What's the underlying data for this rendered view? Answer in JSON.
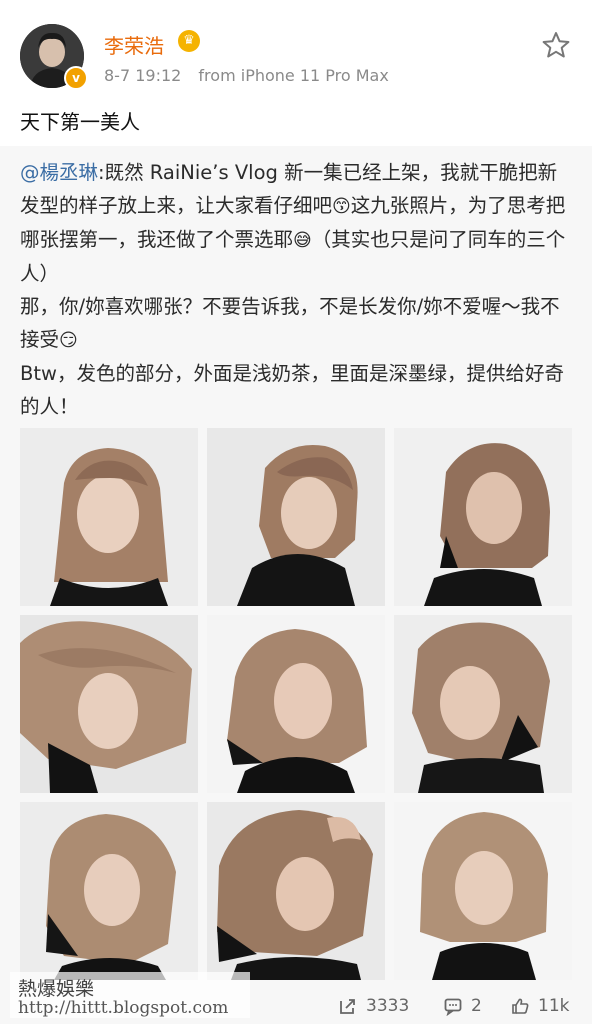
{
  "post": {
    "author": "李荣浩",
    "time": "8-7 19:12",
    "source": "from iPhone 11 Pro Max",
    "text": "天下第一美人"
  },
  "repost": {
    "mention": "@楊丞琳",
    "text": ":既然 RaiNie’s Vlog 新一集已经上架，我就干脆把新发型的样子放上来，让大家看仔细吧",
    "text2": "这九张照片，为了思考把哪张摆第一，我还做了个票选耶",
    "text3": "（其实也只是问了同车的三个人）",
    "line2": "那，你/妳喜欢哪张？不要告诉我，不是长发你/妳不爱喔～我不接受",
    "line3": "Btw，发色的部分，外面是浅奶茶，里面是深墨绿，提供给好奇的人！"
  },
  "photos": [
    {
      "name": "photo-1"
    },
    {
      "name": "photo-2"
    },
    {
      "name": "photo-3"
    },
    {
      "name": "photo-4"
    },
    {
      "name": "photo-5"
    },
    {
      "name": "photo-6"
    },
    {
      "name": "photo-7"
    },
    {
      "name": "photo-8"
    },
    {
      "name": "photo-9"
    }
  ],
  "footer": {
    "reposts": "3333",
    "comments": "2",
    "likes": "11k"
  },
  "watermark": {
    "line1": "熱爆娛樂",
    "line2": "http://hittt.blogspot.com"
  },
  "icons": {
    "verified": "verified-badge-icon",
    "crown": "crown-icon",
    "star": "star-icon",
    "repost": "repost-icon",
    "comment": "comment-icon",
    "like": "like-icon"
  },
  "colors": {
    "username": "#e96b0c",
    "mention": "#3c6ea5",
    "meta": "#8a8a8a",
    "badge": "#f2a100"
  }
}
